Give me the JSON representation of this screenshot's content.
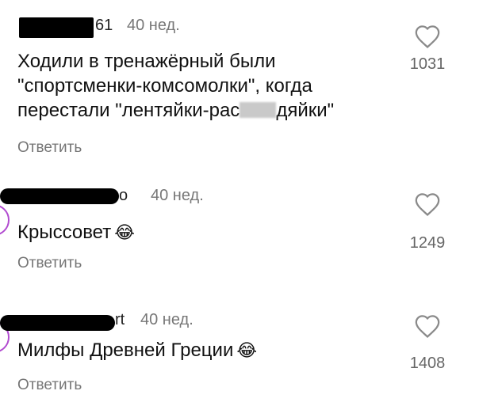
{
  "comments": [
    {
      "username_visible": "61",
      "time": "40 нед.",
      "text_lines": [
        "Ходили в тренажёрный были",
        "\"спортсменки-комсомолки\", когда",
        "перестали \"лентяйки-рас"
      ],
      "text_line3_tail": "дяйки\"",
      "likes": "1031",
      "reply_label": "Ответить"
    },
    {
      "username_visible": "o",
      "time": "40 нед.",
      "text": "Крыссовет",
      "emoji": "😂",
      "likes": "1249",
      "reply_label": "Ответить"
    },
    {
      "username_visible": "rt",
      "time": "40 нед.",
      "text": "Милфы Древней Греции",
      "emoji": "😂",
      "likes": "1408",
      "reply_label": "Ответить"
    }
  ],
  "icons": {
    "like": "heart-outline-icon",
    "emoji": "laughing-tears-emoji"
  },
  "colors": {
    "text": "#111111",
    "muted": "#777777",
    "avatar_ring": "#b14bd0"
  }
}
